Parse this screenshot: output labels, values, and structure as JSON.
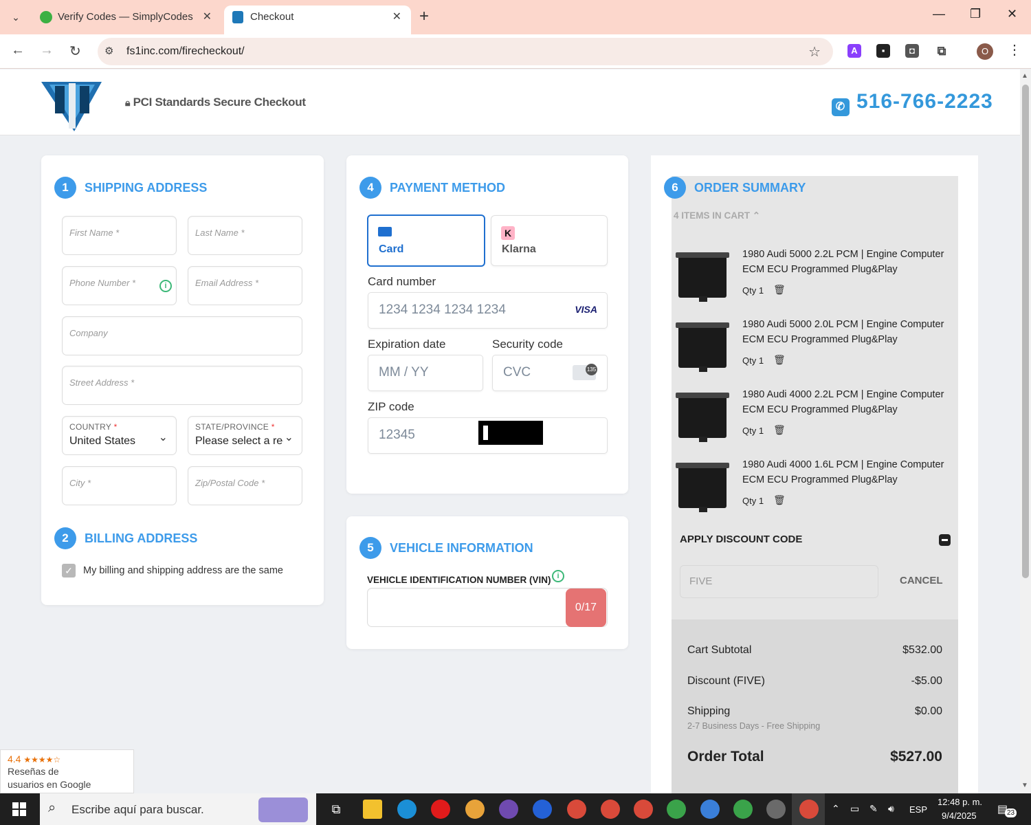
{
  "browser": {
    "tabs": [
      {
        "title": "Verify Codes — SimplyCodes",
        "active": false
      },
      {
        "title": "Checkout",
        "active": true
      }
    ],
    "url": "fs1inc.com/firecheckout/",
    "profile_initial": "O"
  },
  "header": {
    "secure_text": "PCI Standards Secure Checkout",
    "phone": "516-766-2223"
  },
  "shipping": {
    "step": "1",
    "title": "SHIPPING ADDRESS",
    "first_name": "First Name *",
    "last_name": "Last Name *",
    "phone": "Phone Number *",
    "email": "Email Address *",
    "company": "Company",
    "street": "Street Address *",
    "country_label": "COUNTRY",
    "country_value": "United States",
    "state_label": "STATE/PROVINCE",
    "state_value": "Please select a region",
    "required_mark": "*",
    "city": "City *",
    "zip": "Zip/Postal Code *"
  },
  "billing": {
    "step": "2",
    "title": "BILLING ADDRESS",
    "same_label": "My billing and shipping address are the same",
    "checked": true
  },
  "payment": {
    "step": "4",
    "title": "PAYMENT METHOD",
    "tab_card": "Card",
    "tab_klarna": "Klarna",
    "klarna_icon": "K",
    "card_number_label": "Card number",
    "card_number_placeholder": "1234 1234 1234 1234",
    "card_brand": "VISA",
    "expiry_label": "Expiration date",
    "expiry_placeholder": "MM / YY",
    "cvc_label": "Security code",
    "cvc_placeholder": "CVC",
    "cvc_badge": "135",
    "zip_label": "ZIP code",
    "zip_placeholder": "12345"
  },
  "vehicle": {
    "step": "5",
    "title": "VEHICLE INFORMATION",
    "vin_label": "VEHICLE IDENTIFICATION NUMBER (VIN)",
    "counter": "0/17"
  },
  "summary": {
    "step": "6",
    "title": "ORDER SUMMARY",
    "items_in_cart": "4 ITEMS IN CART",
    "items": [
      {
        "name": "1980 Audi 5000 2.2L PCM | Engine Computer ECM ECU Programmed Plug&Play",
        "qty": "Qty 1"
      },
      {
        "name": "1980 Audi 5000 2.0L PCM | Engine Computer ECM ECU Programmed Plug&Play",
        "qty": "Qty 1"
      },
      {
        "name": "1980 Audi 4000 2.2L PCM | Engine Computer ECM ECU Programmed Plug&Play",
        "qty": "Qty 1"
      },
      {
        "name": "1980 Audi 4000 1.6L PCM | Engine Computer ECM ECU Programmed Plug&Play",
        "qty": "Qty 1"
      }
    ],
    "discount_title": "APPLY DISCOUNT CODE",
    "discount_code": "FIVE",
    "cancel_label": "CANCEL",
    "subtotal_label": "Cart Subtotal",
    "subtotal": "$532.00",
    "discount_label": "Discount (FIVE)",
    "discount": "-$5.00",
    "shipping_label": "Shipping",
    "shipping": "$0.00",
    "shipping_note": "2-7 Business Days - Free Shipping",
    "total_label": "Order Total",
    "total": "$527.00"
  },
  "google_badge": {
    "rating": "4.4",
    "line1": "Reseñas de",
    "line2": "usuarios en Google"
  },
  "taskbar": {
    "search_placeholder": "Escribe aquí para buscar.",
    "language": "ESP",
    "time": "12:48 p. m.",
    "date": "9/4/2025",
    "notifications": "23"
  },
  "colors": {
    "accent": "#3d9bea",
    "tab_bar": "#fcd7cc",
    "vin_counter": "#e57373",
    "card_tab_border": "#1f6fcf"
  }
}
